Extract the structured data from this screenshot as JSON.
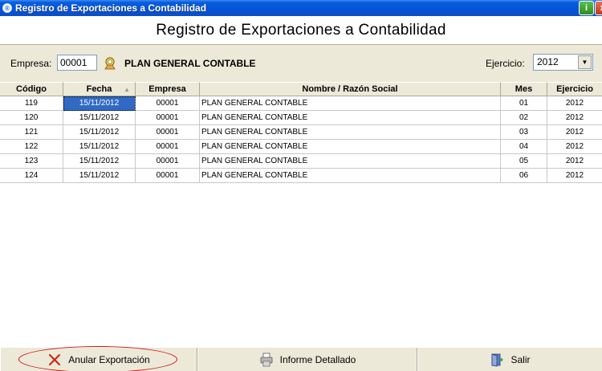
{
  "window": {
    "title": "Registro de Exportaciones a Contabilidad",
    "info_btn": "i",
    "close_btn": "x"
  },
  "header": {
    "title": "Registro de Exportaciones a Contabilidad"
  },
  "filters": {
    "empresa_label": "Empresa:",
    "empresa_value": "00001",
    "empresa_name": "PLAN GENERAL CONTABLE",
    "ejercicio_label": "Ejercicio:",
    "ejercicio_value": "2012"
  },
  "table": {
    "columns": [
      "Código",
      "Fecha",
      "Empresa",
      "Nombre / Razón Social",
      "Mes",
      "Ejercicio"
    ],
    "rows": [
      [
        "119",
        "15/11/2012",
        "00001",
        "PLAN GENERAL CONTABLE",
        "01",
        "2012"
      ],
      [
        "120",
        "15/11/2012",
        "00001",
        "PLAN GENERAL CONTABLE",
        "02",
        "2012"
      ],
      [
        "121",
        "15/11/2012",
        "00001",
        "PLAN GENERAL CONTABLE",
        "03",
        "2012"
      ],
      [
        "122",
        "15/11/2012",
        "00001",
        "PLAN GENERAL CONTABLE",
        "04",
        "2012"
      ],
      [
        "123",
        "15/11/2012",
        "00001",
        "PLAN GENERAL CONTABLE",
        "05",
        "2012"
      ],
      [
        "124",
        "15/11/2012",
        "00001",
        "PLAN GENERAL CONTABLE",
        "06",
        "2012"
      ]
    ]
  },
  "toolbar": {
    "anular_label": "Anular Exportación",
    "informe_label": "Informe Detallado",
    "salir_label": "Salir"
  },
  "icons": {
    "search": "search-icon",
    "anular": "x-icon",
    "informe": "printer-icon",
    "salir": "exit-door-icon"
  },
  "colors": {
    "titlebar": "#0A5DDB",
    "selection": "#316AC5",
    "annotation": "#D01010"
  }
}
